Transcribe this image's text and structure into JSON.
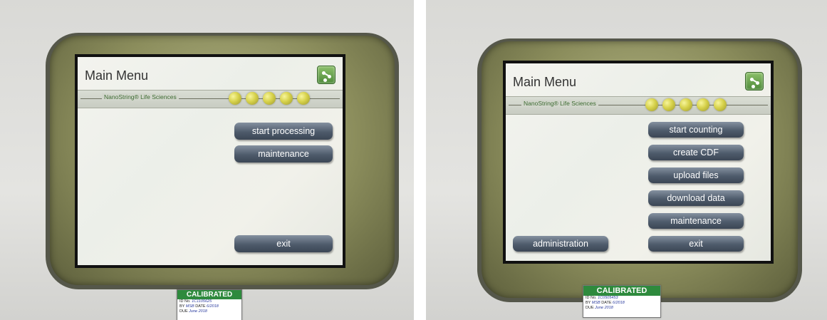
{
  "left_panel": {
    "title": "Main Menu",
    "brand": "NanoString® Life Sciences",
    "buttons": {
      "start_processing": "start processing",
      "maintenance": "maintenance",
      "exit": "exit"
    },
    "sticker": {
      "heading": "CALIBRATED",
      "id_label": "ID No.",
      "id_value": "1C1105625",
      "by_label": "BY",
      "by_value": "MSB",
      "date_label": "DATE",
      "date_value": "6/2018",
      "due_label": "DUE",
      "due_value": "June 2018"
    }
  },
  "right_panel": {
    "title": "Main Menu",
    "brand": "NanoString® Life Sciences",
    "buttons": {
      "start_counting": "start counting",
      "create_cdf": "create CDF",
      "upload_files": "upload files",
      "download_data": "download data",
      "maintenance": "maintenance",
      "administration": "administration",
      "exit": "exit"
    },
    "sticker": {
      "heading": "CALIBRATED",
      "id_label": "ID No.",
      "id_value": "1C0505453",
      "by_label": "BY",
      "by_value": "MSB",
      "date_label": "DATE",
      "date_value": "6/2018",
      "due_label": "DUE",
      "due_value": "June 2018"
    }
  },
  "colors": {
    "button": "#4e5b6b",
    "bezel": "#8b8d5c",
    "indicator_dot": "#d6d14a",
    "brand_text": "#3d6b32",
    "sticker_header": "#2e8a3d"
  }
}
